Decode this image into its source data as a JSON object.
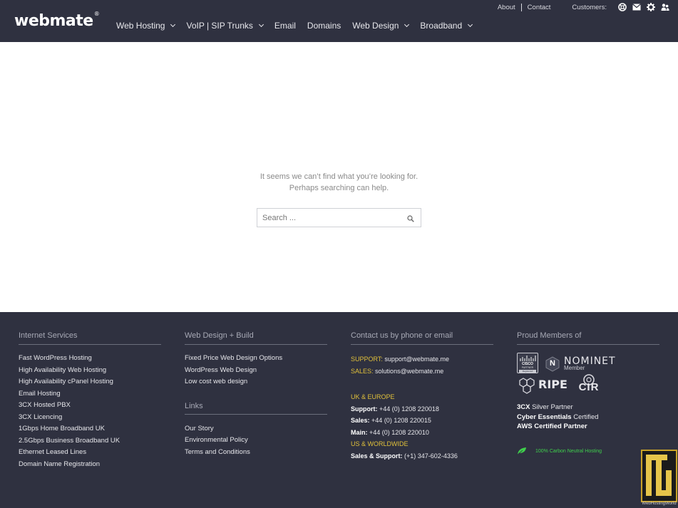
{
  "header": {
    "logo": "webmate",
    "logo_mark": "®",
    "nav": [
      {
        "label": "Web Hosting",
        "dropdown": true
      },
      {
        "label": "VoIP | SIP Trunks",
        "dropdown": true
      },
      {
        "label": "Email",
        "dropdown": false
      },
      {
        "label": "Domains",
        "dropdown": false
      },
      {
        "label": "Web Design",
        "dropdown": true
      },
      {
        "label": "Broadband",
        "dropdown": true
      }
    ],
    "top_links": {
      "about": "About",
      "contact": "Contact",
      "customers": "Customers:"
    },
    "customer_icons": [
      "support-icon",
      "mail-icon",
      "gear-icon",
      "users-icon"
    ]
  },
  "main": {
    "message_line1": "It seems we can’t find what you’re looking for.",
    "message_line2": "Perhaps searching can help.",
    "search": {
      "placeholder": "Search ...",
      "value": ""
    }
  },
  "footer": {
    "col1": {
      "heading": "Internet Services",
      "links": [
        "Fast WordPress Hosting",
        "High Availability Web Hosting",
        "High Availability cPanel Hosting",
        "Email Hosting",
        "3CX Hosted PBX",
        "3CX Licencing",
        "1Gbps Home Broadband UK",
        "2.5Gbps Business Broadband UK",
        "Ethernet Leased Lines",
        "Domain Name Registration"
      ]
    },
    "col2": {
      "heading": "Web Design + Build",
      "links": [
        "Fixed Price Web Design Options",
        "WordPress Web Design",
        "Low cost web design"
      ],
      "heading2": "Links",
      "links2": [
        "Our Story",
        "Environmental Policy",
        "Terms and Conditions"
      ]
    },
    "col3": {
      "heading": "Contact us by phone or email",
      "support_label": "SUPPORT:",
      "support_email": "support@webmate.me",
      "sales_label": "SALES:",
      "sales_email": "solutions@webmate.me",
      "uk_heading": "UK & EUROPE",
      "uk_lines": [
        {
          "label": "Support:",
          "value": "+44 (0) 1208 220018"
        },
        {
          "label": "Sales:",
          "value": "+44 (0) 1208 220015"
        },
        {
          "label": "Main:",
          "value": "+44 (0) 1208 220010"
        }
      ],
      "us_heading": "US & WORLDWIDE",
      "us_line": {
        "label": "Sales & Support:",
        "value": "(+1)  347-602-4336"
      }
    },
    "col4": {
      "heading": "Proud Members of",
      "logos": {
        "cisco": "CISCO",
        "cisco_sub": "PARTNER",
        "cisco_sub2": "Registered",
        "nominet": "NOMINET",
        "nominet_sub": "Member",
        "nominet_letter": "N",
        "ripe": "RIPE",
        "cir": "CIR"
      },
      "partners": [
        {
          "bold": "3CX",
          "rest": " Silver Partner"
        },
        {
          "bold": "Cyber Essentials",
          "rest": " Certified"
        },
        {
          "bold": "AWS Certified Partner",
          "rest": ""
        }
      ],
      "carbon": "100% Carbon Neutral Hosting"
    }
  },
  "watermark": {
    "text": "WebHostingWorld",
    "letters": "HW"
  },
  "colors": {
    "header_bg": "#2f3140",
    "footer_bg": "#2f3140",
    "accent_yellow": "#e0c03a",
    "carbon_green": "#3fcf4c"
  }
}
